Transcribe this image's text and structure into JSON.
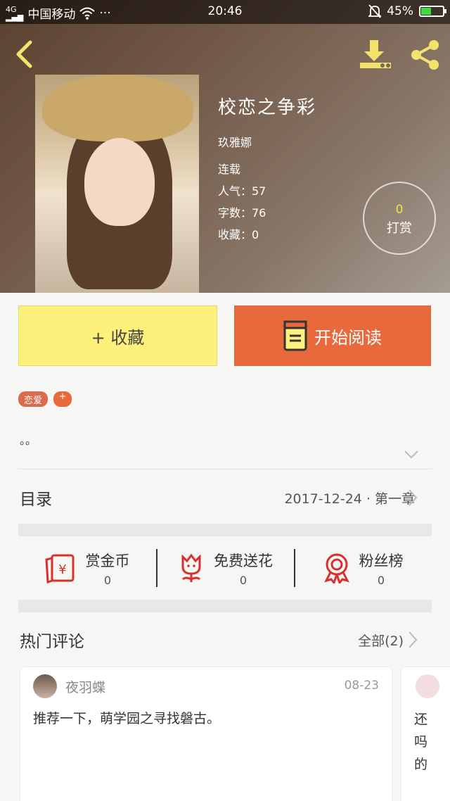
{
  "status": {
    "carrier": "中国移动",
    "dots": "···",
    "time": "20:46",
    "battery": "45%",
    "battery_level": 0.45
  },
  "book": {
    "title": "校恋之争彩",
    "author": "玖雅娜",
    "status": "连载",
    "popularity": "人气：57",
    "words": "字数：76",
    "favorites": "收藏：0"
  },
  "reward": {
    "count": "0",
    "label": "打赏"
  },
  "actions": {
    "collect": "+ 收藏",
    "read": "开始阅读"
  },
  "tags": [
    "恋爱",
    "+"
  ],
  "description": "。。",
  "catalog": {
    "label": "目录",
    "latest": "2017-12-24 · 第一章"
  },
  "stats": [
    {
      "label": "赏金币",
      "value": "0",
      "icon": "red-envelope-icon"
    },
    {
      "label": "免费送花",
      "value": "0",
      "icon": "flower-icon"
    },
    {
      "label": "粉丝榜",
      "value": "0",
      "icon": "medal-icon"
    }
  ],
  "comments": {
    "title": "热门评论",
    "all": "全部(2)",
    "items": [
      {
        "user": "夜羽蝶",
        "date": "08-23",
        "text": "推荐一下，萌学园之寻找磐古。"
      },
      {
        "text": "还吗的"
      }
    ]
  },
  "colors": {
    "accent": "#e8693c",
    "collect_bg": "#fdf17b",
    "tag": "#d96b4e",
    "icon_red": "#d8312b"
  }
}
